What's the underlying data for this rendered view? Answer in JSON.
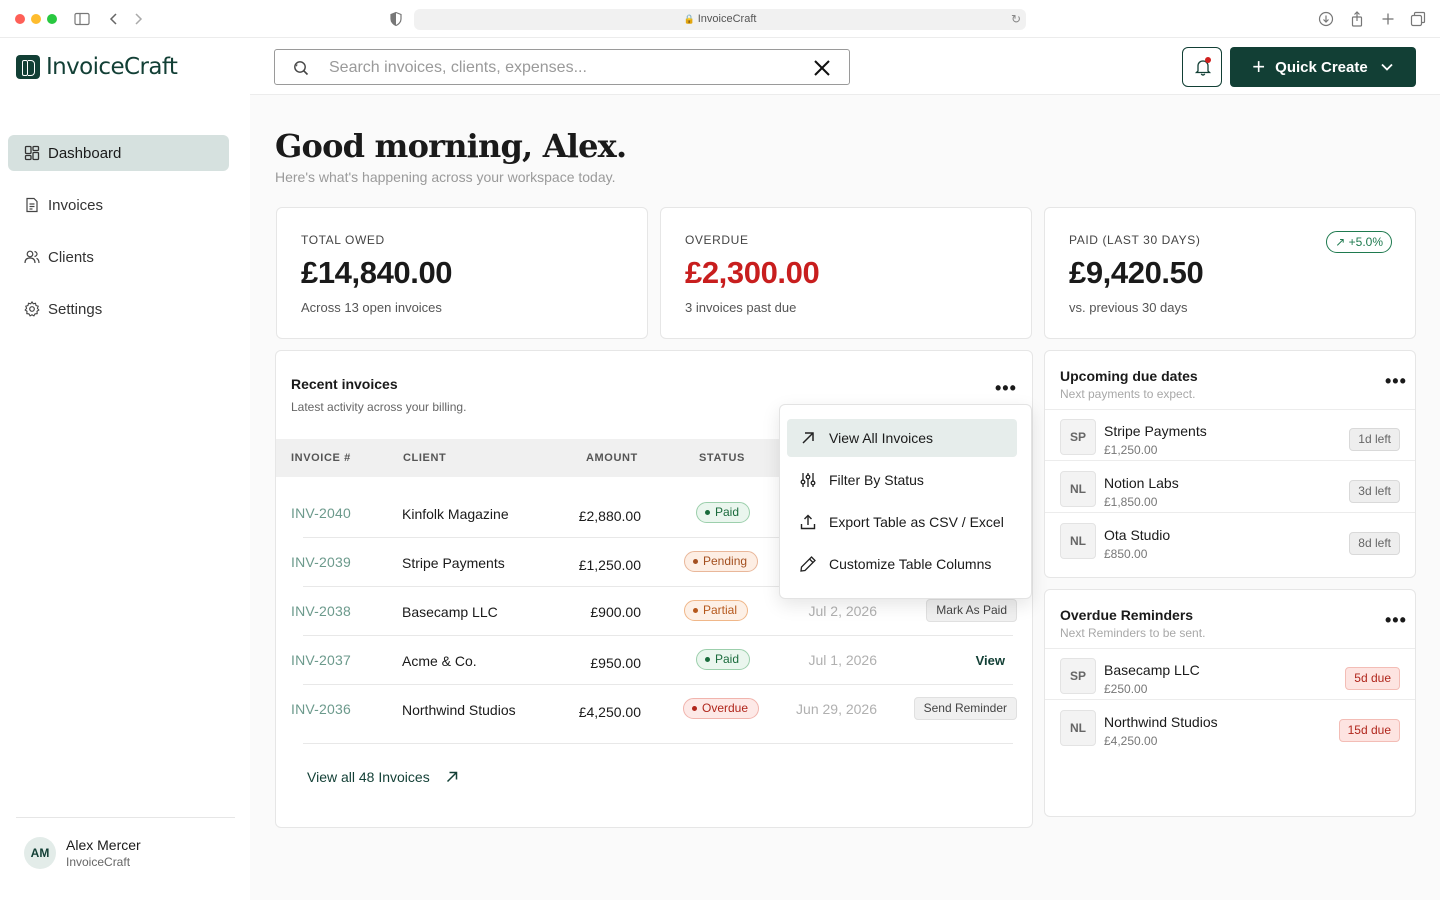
{
  "browser": {
    "url": "InvoiceCraft"
  },
  "brand": {
    "name": "InvoiceCraft",
    "accent": "#123f35"
  },
  "sidebar": {
    "items": [
      {
        "label": "Dashboard",
        "icon": "dashboard-icon",
        "active": true
      },
      {
        "label": "Invoices",
        "icon": "file-icon"
      },
      {
        "label": "Clients",
        "icon": "users-icon"
      },
      {
        "label": "Settings",
        "icon": "gear-icon"
      }
    ],
    "user": {
      "initials": "AM",
      "name": "Alex Mercer",
      "org": "InvoiceCraft"
    }
  },
  "header": {
    "search_placeholder": "Search invoices, clients, expenses...",
    "quick_create": "Quick Create"
  },
  "greeting": {
    "title": "Good morning, Alex.",
    "subtitle": "Here's what's happening across your workspace today."
  },
  "stats": [
    {
      "label": "TOTAL OWED",
      "value": "£14,840.00",
      "note": "Across 13 open invoices"
    },
    {
      "label": "OVERDUE",
      "value": "£2,300.00",
      "note": "3 invoices past due",
      "color": "#c81e1e"
    },
    {
      "label": "PAID (LAST 30 DAYS)",
      "value": "£9,420.50",
      "note": "vs. previous 30 days",
      "trend": "+5.0%"
    }
  ],
  "recent": {
    "title": "Recent invoices",
    "subtitle": "Latest activity across your billing.",
    "columns": [
      "INVOICE #",
      "CLIENT",
      "AMOUNT",
      "STATUS"
    ],
    "rows": [
      {
        "id": "INV-2040",
        "client": "Kinfolk Magazine",
        "amount": "£2,880.00",
        "status": "Paid",
        "date": "",
        "action": ""
      },
      {
        "id": "INV-2039",
        "client": "Stripe Payments",
        "amount": "£1,250.00",
        "status": "Pending",
        "date": "",
        "action": ""
      },
      {
        "id": "INV-2038",
        "client": "Basecamp LLC",
        "amount": "£900.00",
        "status": "Partial",
        "date": "Jul 2, 2026",
        "action": "Mark As Paid"
      },
      {
        "id": "INV-2037",
        "client": "Acme & Co.",
        "amount": "£950.00",
        "status": "Paid",
        "date": "Jul 1, 2026",
        "action": "View"
      },
      {
        "id": "INV-2036",
        "client": "Northwind Studios",
        "amount": "£4,250.00",
        "status": "Overdue",
        "date": "Jun 29, 2026",
        "action": "Send Reminder"
      }
    ],
    "view_all": "View all 48 Invoices"
  },
  "menu": {
    "items": [
      {
        "label": "View All Invoices",
        "icon": "arrow-up-right-icon"
      },
      {
        "label": "Filter By Status",
        "icon": "sliders-icon"
      },
      {
        "label": "Export Table as CSV / Excel",
        "icon": "upload-icon"
      },
      {
        "label": "Customize Table Columns",
        "icon": "pencil-icon"
      }
    ]
  },
  "upcoming": {
    "title": "Upcoming due dates",
    "subtitle": "Next payments to expect.",
    "items": [
      {
        "initials": "SP",
        "name": "Stripe Payments",
        "amount": "£1,250.00",
        "badge": "1d left"
      },
      {
        "initials": "NL",
        "name": "Notion Labs",
        "amount": "£1,850.00",
        "badge": "3d left"
      },
      {
        "initials": "NL",
        "name": "Ota Studio",
        "amount": "£850.00",
        "badge": "8d left"
      }
    ]
  },
  "reminders": {
    "title": "Overdue Reminders",
    "subtitle": "Next Reminders to be sent.",
    "items": [
      {
        "initials": "SP",
        "name": "Basecamp LLC",
        "amount": "£250.00",
        "badge": "5d due"
      },
      {
        "initials": "NL",
        "name": "Northwind Studios",
        "amount": "£4,250.00",
        "badge": "15d due"
      }
    ]
  }
}
